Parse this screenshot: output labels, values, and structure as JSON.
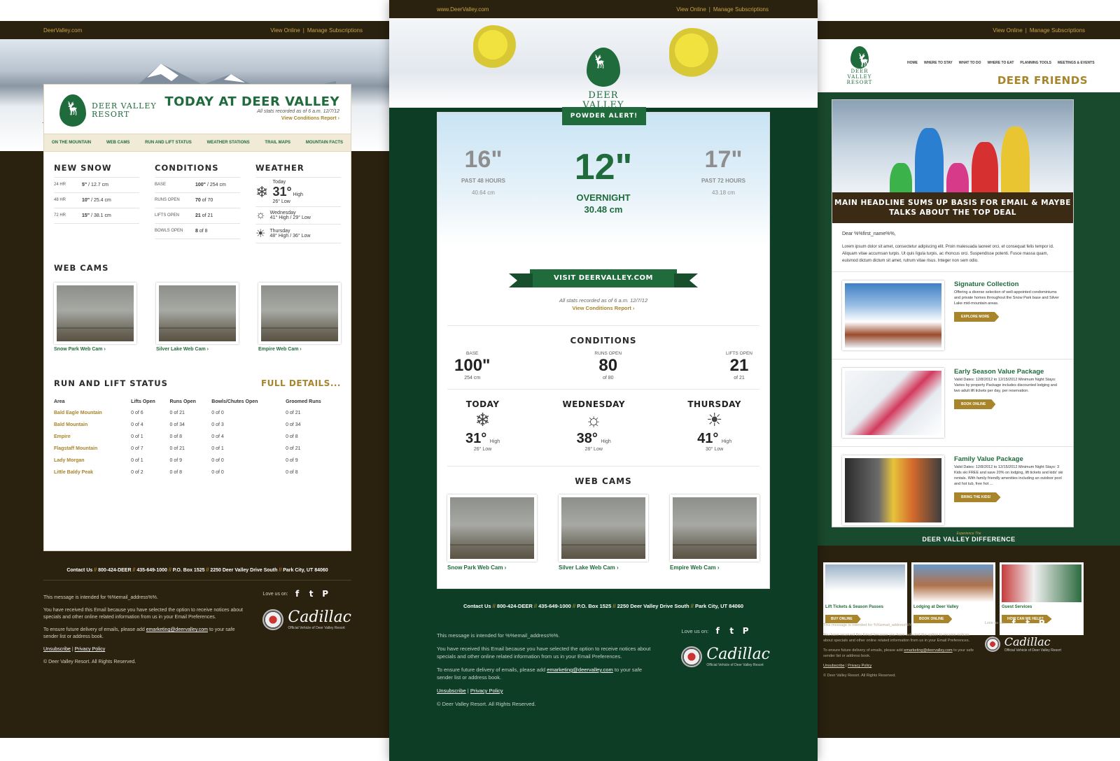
{
  "common": {
    "site": "DeerValley.com",
    "site_alt": "www.DeerValley.com",
    "view_online": "View Online",
    "manage_subs": "Manage Subscriptions",
    "logo_line1": "DEER VALLEY",
    "logo_line2": "RESORT",
    "stats_note": "All stats recorded as of 6 a.m. 12/7/12",
    "view_conditions": "View Conditions Report ›",
    "contact": "Contact Us",
    "phone1": "800-424-DEER",
    "phone2": "435-649-1000",
    "pobox": "P.O. Box 1525",
    "street": "2250 Deer Valley Drive South",
    "city": "Park City, UT 84060",
    "intended": "This message is intended for %%email_address%%.",
    "received": "You have received this Email because you have selected the option to receive notices about specials and other online related information from us in your Email Preferences.",
    "ensure_pre": "To ensure future delivery of emails, please add",
    "ensure_email": "emarketing@deervalley.com",
    "ensure_post": "to your safe sender list or address book.",
    "love_us": "Love us on:",
    "unsubscribe": "Unsubscribe",
    "privacy": "Privacy Policy",
    "copyright": "© Deer Valley Resort. All Rights Reserved.",
    "cadillac": "Cadillac",
    "cadillac_sub": "Official Vehicle of Deer Valley Resort"
  },
  "left": {
    "title": "TODAY AT DEER VALLEY",
    "nav": [
      "ON THE MOUNTAIN",
      "WEB CAMS",
      "RUN AND LIFT STATUS",
      "WEATHER STATIONS",
      "TRAIL MAPS",
      "MOUNTAIN FACTS"
    ],
    "new_snow_title": "NEW SNOW",
    "new_snow": [
      {
        "k": "24 HR",
        "v": "5\"",
        "m": "/ 12.7 cm"
      },
      {
        "k": "48 HR",
        "v": "10\"",
        "m": "/ 25.4 cm"
      },
      {
        "k": "72 HR",
        "v": "15\"",
        "m": "/ 38.1 cm"
      }
    ],
    "conditions_title": "CONDITIONS",
    "conditions": [
      {
        "k": "BASE",
        "v": "100\"",
        "m": "/ 254 cm"
      },
      {
        "k": "RUNS OPEN",
        "v": "70",
        "m": "of 70"
      },
      {
        "k": "LIFTS OPEN",
        "v": "21",
        "m": "of 21"
      },
      {
        "k": "BOWLS OPEN",
        "v": "8",
        "m": "of 8"
      }
    ],
    "weather_title": "WEATHER",
    "today_label": "Today",
    "today_temp": "31°",
    "today_high": "High",
    "today_low": "26° Low",
    "wed_label": "Wednesday",
    "wed_temps": "41° High / 29° Low",
    "thu_label": "Thursday",
    "thu_temps": "48° High / 36° Low",
    "webcams_title": "WEB CAMS",
    "cams": [
      "Snow Park Web Cam ›",
      "Silver Lake Web Cam ›",
      "Empire Web Cam ›"
    ],
    "status_title": "RUN AND LIFT STATUS",
    "full_details": "FULL DETAILS...",
    "table_headers": [
      "Area",
      "Lifts Open",
      "Runs Open",
      "Bowls/Chutes Open",
      "Groomed Runs"
    ],
    "table_rows": [
      [
        "Bald Eagle Mountain",
        "0 of 6",
        "0 of 21",
        "0 of 0",
        "0 of 21"
      ],
      [
        "Bald Mountain",
        "0 of 4",
        "0 of 34",
        "0 of 3",
        "0 of 34"
      ],
      [
        "Empire",
        "0 of 1",
        "0 of 8",
        "0 of 4",
        "0 of 8"
      ],
      [
        "Flagstaff Mountain",
        "0 of 7",
        "0 of 21",
        "0 of 1",
        "0 of 21"
      ],
      [
        "Lady Morgan",
        "0 of 1",
        "0 of 9",
        "0 of 0",
        "0 of 9"
      ],
      [
        "Little Baldy Peak",
        "0 of 2",
        "0 of 8",
        "0 of 0",
        "0 of 8"
      ]
    ]
  },
  "center": {
    "powder_alert": "POWDER ALERT!",
    "past48_val": "16\"",
    "past48_label": "PAST 48 HOURS",
    "past48_cm": "40.64 cm",
    "overnight_val": "12\"",
    "overnight_label": "OVERNIGHT",
    "overnight_cm": "30.48 cm",
    "past72_val": "17\"",
    "past72_label": "PAST 72 HOURS",
    "past72_cm": "43.18 cm",
    "visit": "VISIT DEERVALLEY.COM",
    "conditions_title": "CONDITIONS",
    "base_label": "BASE",
    "base_val": "100\"",
    "base_sub": "254 cm",
    "runs_label": "RUNS OPEN",
    "runs_val": "80",
    "runs_sub": "of 80",
    "lifts_label": "LIFTS OPEN",
    "lifts_val": "21",
    "lifts_sub": "of 21",
    "today": "TODAY",
    "today_temp": "31°",
    "today_low": "26° Low",
    "wednesday": "WEDNESDAY",
    "wed_temp": "38°",
    "wed_low": "28° Low",
    "thursday": "THURSDAY",
    "thu_temp": "41°",
    "thu_low": "30° Low",
    "high": "High",
    "webcams_title": "WEB CAMS",
    "cams": [
      "Snow Park Web Cam ›",
      "Silver Lake Web Cam ›",
      "Empire Web Cam ›"
    ]
  },
  "right": {
    "nav": [
      "HOME",
      "WHERE TO STAY",
      "WHAT TO DO",
      "WHERE TO EAT",
      "PLANNING TOOLS",
      "MEETINGS & EVENTS"
    ],
    "title": "DEER FRIENDS",
    "headline": "MAIN HEADLINE SUMS UP BASIS FOR EMAIL & MAYBE TALKS ABOUT THE TOP DEAL",
    "dear": "Dear %%first_name%%,",
    "lorem": "Lorem ipsum dolor sit amet, consectetur adipiscing elit. Proin malesuada laoreet orci, et consequat felis tempor id. Aliquam vitae accumsan turpis. Ut quis ligula turpis, ac rhoncus orci. Suspendisse potenti. Fusce massa quam, euismod dictum dictum sit amet, rutrum vitae risus. Integer non sem odio.",
    "offers": [
      {
        "title": "Signature Collection",
        "text": "Offering a diverse selection of well-appointed condominiums and private homes throughout the Snow Park base and Silver Lake mid-mountain areas.",
        "btn": "EXPLORE MORE"
      },
      {
        "title": "Early Season Value Package",
        "text": "Valid Dates: 12/8/2012 to 12/15/2012 Minimum Night Stays: Varies by property Package includes discounted lodging and two adult lift tickets per day, per reservation.",
        "btn": "BOOK ONLINE"
      },
      {
        "title": "Family Value Package",
        "text": "Valid Dates: 12/8/2012 to 12/15/2012 Minimum Night Stays: 3 Kids ski FREE and save 20% on lodging, lift tickets and kids' ski rentals. With family friendly amenities including an outdoor pool and hot tub, free hot ...",
        "btn": "BRING THE KIDS!"
      }
    ],
    "experience": "Experience The",
    "difference": "DEER VALLEY DIFFERENCE",
    "tiles": [
      {
        "title": "Lift Tickets & Season Passes",
        "btn": "BUY ONLINE"
      },
      {
        "title": "Lodging at Deer Valley",
        "btn": "BOOK ONLINE"
      },
      {
        "title": "Guest Services",
        "btn": "HOW CAN WE HELP?"
      }
    ]
  },
  "colors": {
    "brand_green": "#1f6b3c",
    "dark_green": "#0e3d25",
    "gold": "#a8842a",
    "dark_brown": "#2a210f"
  }
}
